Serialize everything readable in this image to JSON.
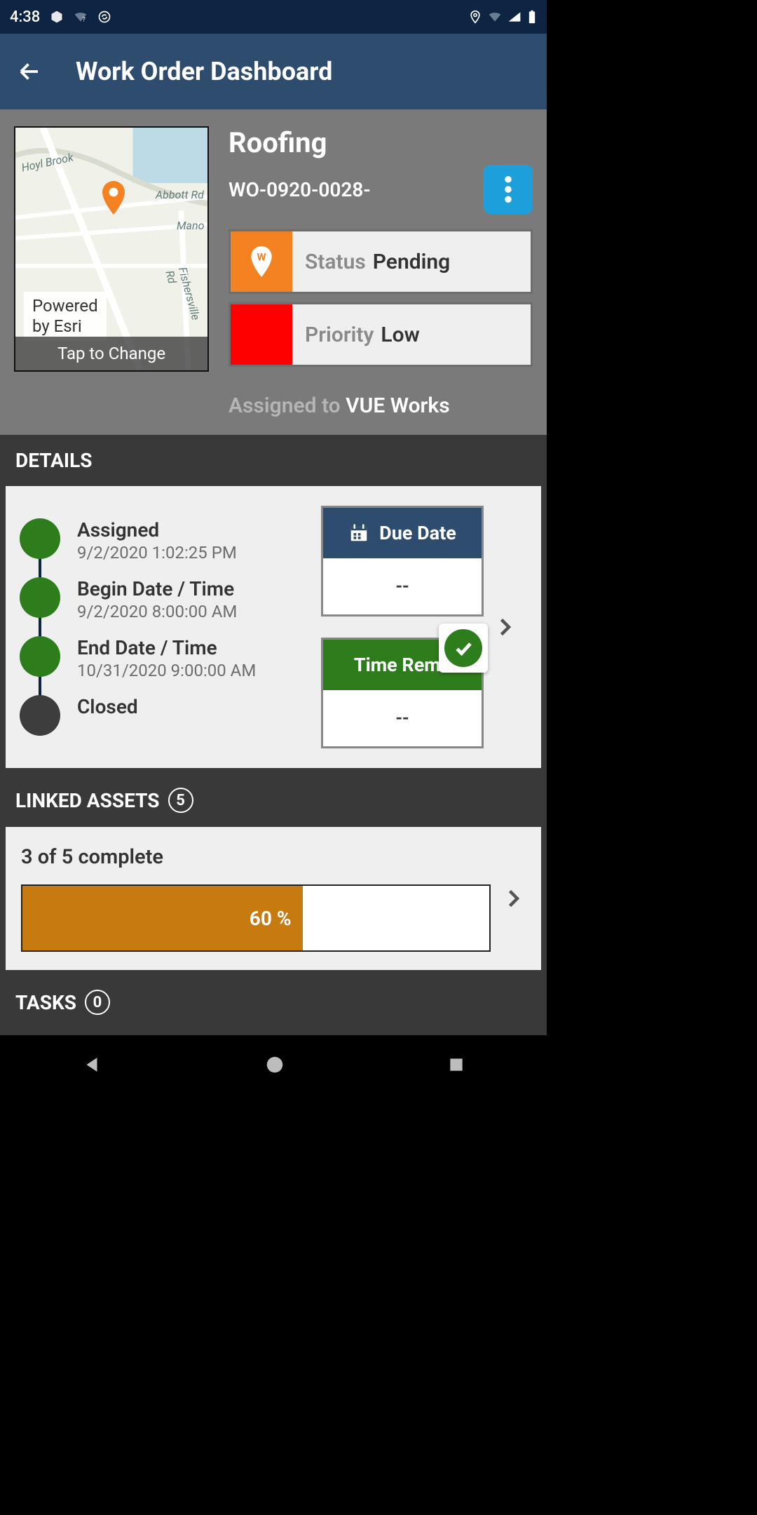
{
  "statusbar": {
    "time": "4:38"
  },
  "header": {
    "title": "Work Order Dashboard"
  },
  "workorder": {
    "title": "Roofing",
    "id": "WO-0920-0028-",
    "status_label": "Status",
    "status_value": "Pending",
    "priority_label": "Priority",
    "priority_value": "Low",
    "assigned_label": "Assigned to",
    "assigned_value": "VUE Works"
  },
  "map": {
    "powered_line1": "Powered",
    "powered_line2": "by Esri",
    "tap": "Tap to Change",
    "streets": {
      "hoyl": "Hoyl Brook",
      "abbott": "Abbott Rd",
      "mano": "Mano",
      "fisher": "Fishersville Rd"
    }
  },
  "details": {
    "heading": "DETAILS",
    "items": [
      {
        "label": "Assigned",
        "sub": "9/2/2020 1:02:25 PM"
      },
      {
        "label": "Begin Date / Time",
        "sub": "9/2/2020 8:00:00 AM"
      },
      {
        "label": "End Date / Time",
        "sub": "10/31/2020 9:00:00 AM"
      },
      {
        "label": "Closed",
        "sub": ""
      }
    ],
    "due_label": "Due Date",
    "due_value": "--",
    "remaining_label": "Time Rema",
    "remaining_value": "--"
  },
  "assets": {
    "heading": "LINKED ASSETS",
    "count": "5",
    "progress_text": "3 of 5 complete",
    "percent_label": "60 %",
    "percent": 60
  },
  "tasks": {
    "heading": "TASKS",
    "count": "0"
  }
}
